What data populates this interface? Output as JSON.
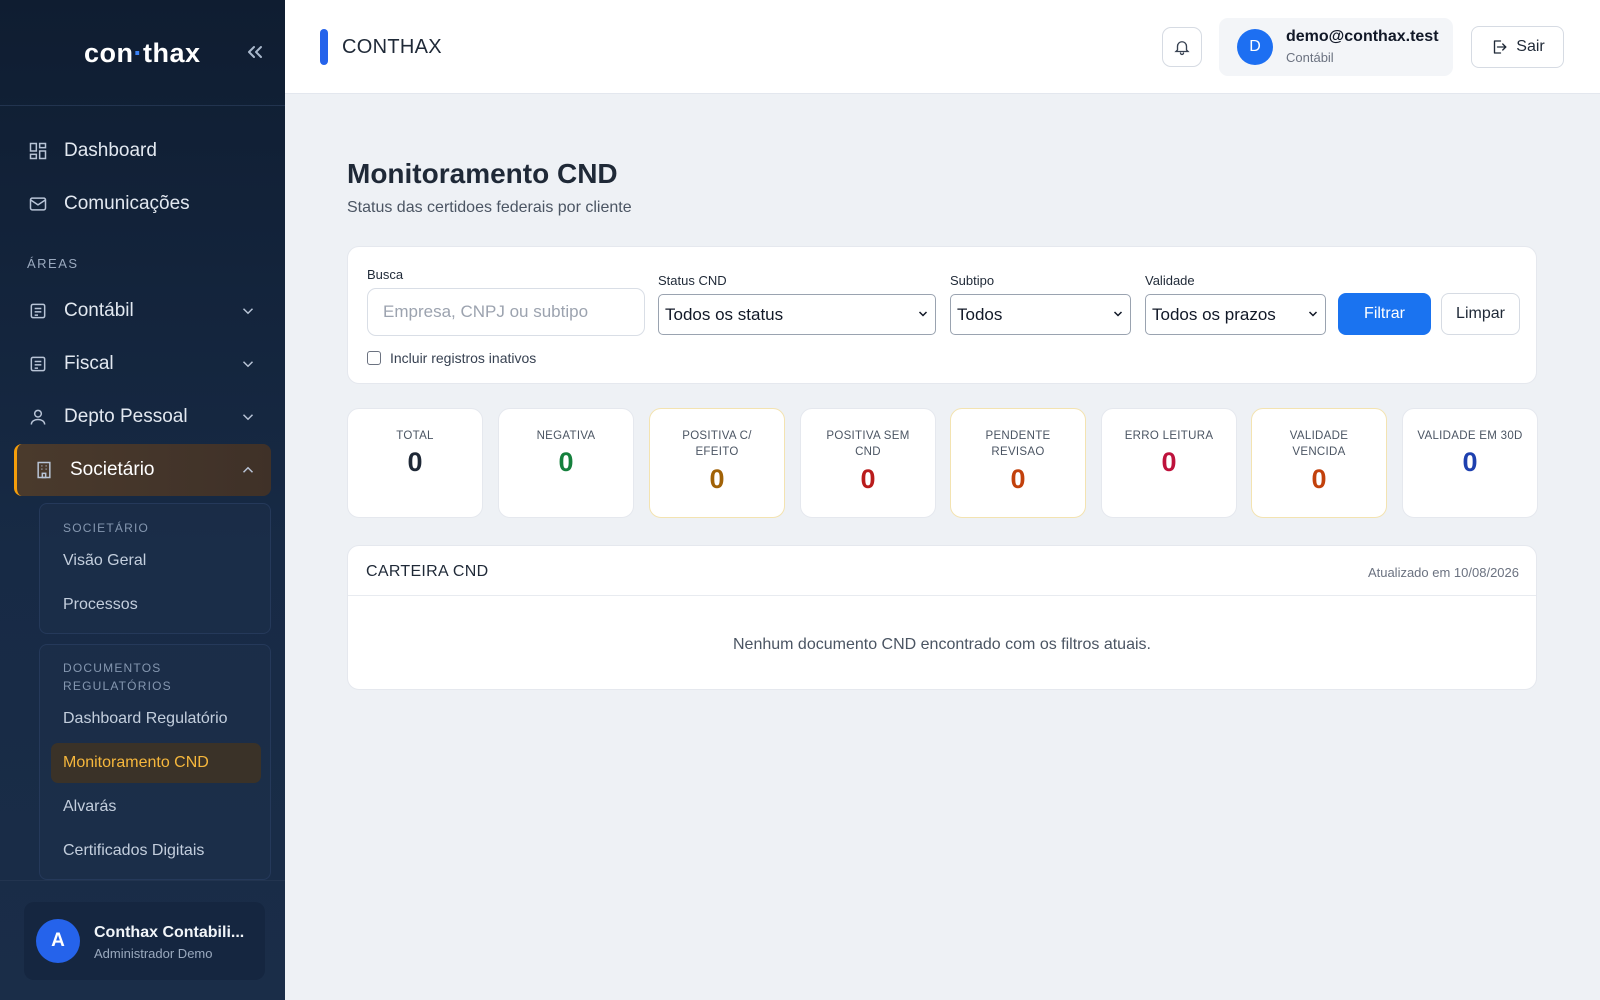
{
  "sidebar": {
    "logo_left": "con",
    "logo_dot": "·",
    "logo_right": "thax",
    "nav": [
      {
        "label": "Dashboard"
      },
      {
        "label": "Comunicações"
      }
    ],
    "areas_label": "ÁREAS",
    "areas": [
      {
        "label": "Contábil"
      },
      {
        "label": "Fiscal"
      },
      {
        "label": "Depto Pessoal"
      },
      {
        "label": "Societário"
      }
    ],
    "groups": [
      {
        "label": "SOCIETÁRIO",
        "items": [
          "Visão Geral",
          "Processos"
        ]
      },
      {
        "label_line1": "DOCUMENTOS",
        "label_line2": "REGULATÓRIOS",
        "items": [
          "Dashboard Regulatório",
          "Monitoramento CND",
          "Alvarás",
          "Certificados Digitais"
        ]
      }
    ],
    "user": {
      "initial": "A",
      "name": "Conthax Contabili...",
      "role": "Administrador Demo"
    }
  },
  "header": {
    "title": "CONTHAX",
    "user_initial": "D",
    "user_email": "demo@conthax.test",
    "user_role": "Contábil",
    "logout_label": "Sair"
  },
  "page": {
    "title": "Monitoramento CND",
    "subtitle": "Status das certidoes federais por cliente"
  },
  "filters": {
    "search_label": "Busca",
    "search_placeholder": "Empresa, CNPJ ou subtipo",
    "status_label": "Status CND",
    "status_value": "Todos os status",
    "subtipo_label": "Subtipo",
    "subtipo_value": "Todos",
    "validade_label": "Validade",
    "validade_value": "Todos os prazos",
    "inactive_label": "Incluir registros inativos",
    "filter_button": "Filtrar",
    "clear_button": "Limpar"
  },
  "stats": [
    {
      "line1": "TOTAL",
      "line2": "",
      "value": "0",
      "color": "#1f2937"
    },
    {
      "line1": "NEGATIVA",
      "line2": "",
      "value": "0",
      "color": "#15803d"
    },
    {
      "line1": "POSITIVA C/",
      "line2": "EFEITO",
      "value": "0",
      "color": "#a16207"
    },
    {
      "line1": "POSITIVA SEM",
      "line2": "CND",
      "value": "0",
      "color": "#b91c1c"
    },
    {
      "line1": "PENDENTE",
      "line2": "REVISAO",
      "value": "0",
      "color": "#c2410c"
    },
    {
      "line1": "ERRO LEITURA",
      "line2": "",
      "value": "0",
      "color": "#be123c"
    },
    {
      "line1": "VALIDADE",
      "line2": "VENCIDA",
      "value": "0",
      "color": "#c2410c"
    },
    {
      "line1": "VALIDADE EM 30D",
      "line2": "",
      "value": "0",
      "color": "#1e40af"
    }
  ],
  "table": {
    "title": "CARTEIRA CND",
    "updated": "Atualizado em 10/08/2026",
    "empty": "Nenhum documento CND encontrado com os filtros atuais."
  },
  "colors": {
    "accent": "#1a73f0",
    "active_nav": "#f59e0b"
  }
}
